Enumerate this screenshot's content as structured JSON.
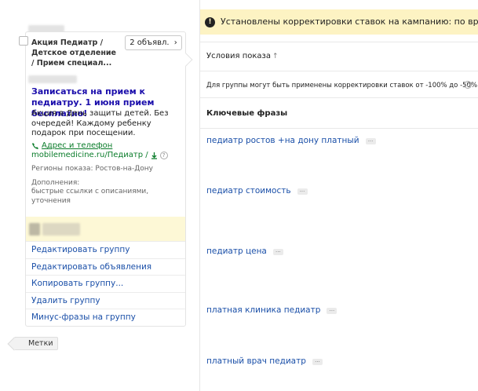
{
  "group": {
    "name": "Акция Педиатр / Детское отделение / Прием специал...",
    "ads_button_label": "2 объявл.",
    "ads_button_chevron": "›"
  },
  "ad": {
    "title": "Записаться на прием к педиатру. 1 июня прием бесплатно!",
    "text": "Акция в День защиты детей. Без очередей! Каждому ребенку подарок при посещении.",
    "contact_link": "Адрес и телефон",
    "display_url": "mobilemedicine.ru/Педиатр /",
    "regions": "Регионы показа: Ростов-на-Дону",
    "extras_label": "Дополнения:",
    "extras_value": "быстрые ссылки с описаниями, уточнения"
  },
  "actions": [
    "Редактировать группу",
    "Редактировать объявления",
    "Копировать группу...",
    "Удалить группу",
    "Минус-фразы на группу"
  ],
  "tags_button_label": "Метки",
  "notice": {
    "icon": "info-icon",
    "text": "Установлены корректировки ставок на кампанию: по временному"
  },
  "table": {
    "col_header": "Условия показа",
    "sort_arrow": "↑",
    "adjust_note": "Для группы могут быть применены корректировки ставок от -100% до -50%",
    "keywords_header": "Ключевые фразы",
    "keywords": [
      "педиатр ростов +на дону платный",
      "педиатр стоимость",
      "педиатр цена",
      "платная клиника педиатр",
      "платный врач педиатр"
    ],
    "more_glyph": "..."
  },
  "colors": {
    "link": "#1a4fa8",
    "ad_title": "#1a0dab",
    "url_green": "#0a7c2a",
    "notice_bg": "#fdf3c3",
    "status_bg": "#fdf8d6"
  }
}
